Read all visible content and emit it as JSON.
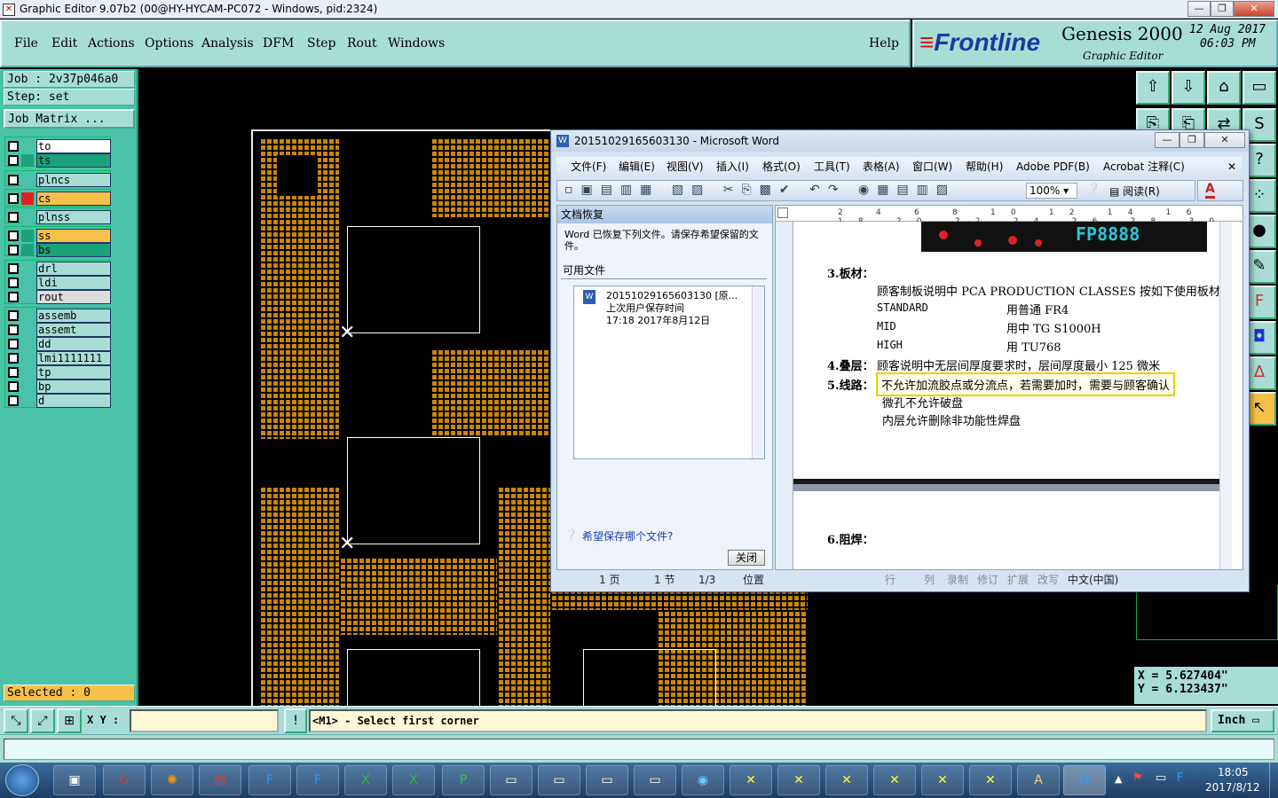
{
  "window": {
    "title": "Graphic Editor 9.07b2 (00@HY-HYCAM-PC072 - Windows, pid:2324)"
  },
  "menu": {
    "items": [
      "File",
      "Edit",
      "Actions",
      "Options",
      "Analysis",
      "DFM",
      "Step",
      "Rout",
      "Windows"
    ],
    "help": "Help"
  },
  "brand": {
    "logo": "Frontline",
    "product": "Genesis 2000",
    "subtitle": "Graphic Editor",
    "date": "12 Aug 2017",
    "time": "06:03 PM"
  },
  "job": {
    "job_label": "Job : 2v37p046a0",
    "step_label": "Step: set",
    "matrix_button": "Job Matrix ..."
  },
  "layers": [
    {
      "name": "to",
      "color": "#ffffff"
    },
    {
      "name": "ts",
      "color": "#1aa37a"
    },
    {
      "name": "plncs",
      "color": "#a8ddd6"
    },
    {
      "name": "cs",
      "color": "#f7c04a"
    },
    {
      "name": "plnss",
      "color": "#a8ddd6"
    },
    {
      "name": "ss",
      "color": "#f7c04a"
    },
    {
      "name": "bs",
      "color": "#1aa37a"
    },
    {
      "name": "drl",
      "color": "#a8ddd6"
    },
    {
      "name": "ldi",
      "color": "#a8ddd6"
    },
    {
      "name": "rout",
      "color": "#dddddd"
    },
    {
      "name": "assemb",
      "color": "#a8ddd6"
    },
    {
      "name": "assemt",
      "color": "#a8ddd6"
    },
    {
      "name": "dd",
      "color": "#a8ddd6"
    },
    {
      "name": "lmi1111111",
      "color": "#a8ddd6"
    },
    {
      "name": "tp",
      "color": "#a8ddd6"
    },
    {
      "name": "bp",
      "color": "#a8ddd6"
    },
    {
      "name": "d",
      "color": "#a8ddd6"
    }
  ],
  "selected": "Selected : 0",
  "statusbar": {
    "xy_label": "X Y :",
    "prompt": "<M1> - Select first corner",
    "units": "Inch"
  },
  "coords": {
    "x": "X  =  5.627404\"",
    "y": "Y  =  6.123437\""
  },
  "word": {
    "title": "20151029165603130 - Microsoft Word",
    "menu": [
      "文件(F)",
      "编辑(E)",
      "视图(V)",
      "插入(I)",
      "格式(O)",
      "工具(T)",
      "表格(A)",
      "窗口(W)",
      "帮助(H)",
      "Adobe PDF(B)",
      "Acrobat 注释(C)"
    ],
    "zoom": "100%",
    "read_button": "阅读(R)",
    "recovery": {
      "header": "文档恢复",
      "intro": "Word 已恢复下列文件。请保存希望保留的文件。",
      "available": "可用文件",
      "file_name": "20151029165603130 [原...",
      "file_desc": "上次用户保存时间",
      "file_time": "17:18 2017年8月12日",
      "help_link": "希望保存哪个文件?",
      "close_button": "关闭"
    },
    "doc": {
      "logo_text": "FP8888",
      "s3_label": "3.板材：",
      "s3_line": "顾客制板说明中 PCA PRODUCTION CLASSES 按如下使用板材",
      "rows": [
        {
          "k": "STANDARD",
          "v": "用普通 FR4"
        },
        {
          "k": "MID",
          "v": "用中 TG S1000H"
        },
        {
          "k": "HIGH",
          "v": "用 TU768"
        }
      ],
      "s4_label": "4.叠层：",
      "s4_line": "顾客说明中无层间厚度要求时，层间厚度最小 125 微米",
      "s5_label": "5.线路：",
      "s5_line1": "不允许加流胶点或分流点，若需要加时，需要与顾客确认",
      "s5_line2": "微孔不允许破盘",
      "s5_line3": "内层允许删除非功能性焊盘",
      "s6_label": "6.阻焊："
    },
    "status": {
      "page": "1 页",
      "section": "1 节",
      "pages": "1/3",
      "pos": "位置",
      "line": "行",
      "col": "列",
      "rec": "录制",
      "trk": "修订",
      "ext": "扩展",
      "ovr": "改写",
      "lang": "中文(中国)"
    }
  },
  "taskbar": {
    "time": "18:05",
    "date": "2017/8/12"
  }
}
